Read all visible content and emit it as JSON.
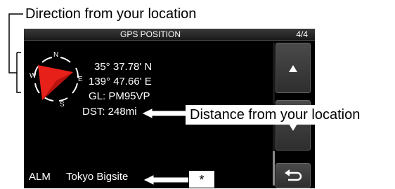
{
  "callouts": {
    "direction": "Direction from your location",
    "distance": "Distance from your location",
    "note_mark": "*"
  },
  "screen": {
    "title": "GPS POSITION",
    "page": "4/4",
    "latitude": "35° 37.78' N",
    "longitude": "139° 47.66' E",
    "grid_locator": "GL: PM95VP",
    "distance": "DST: 248mi",
    "alarm_label": "ALM",
    "alarm_name": "Tokyo Bigsite"
  },
  "compass": {
    "n": "N",
    "e": "E",
    "s": "S",
    "w": "W"
  },
  "buttons": {
    "up_icon": "triangle-up-icon",
    "down_icon": "triangle-down-icon",
    "back_icon": "return-arrow-icon"
  },
  "colors": {
    "pointer": "#e8201a",
    "screen_bg": "#000000"
  }
}
